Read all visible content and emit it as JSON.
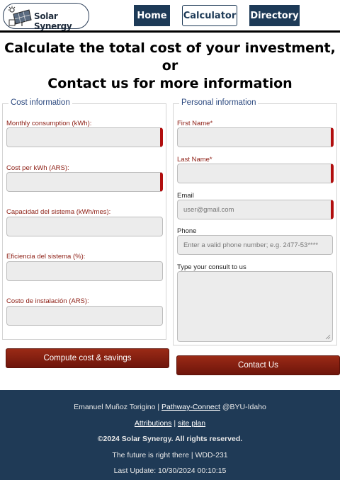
{
  "header": {
    "logo_text": "Solar Synergy",
    "nav": {
      "home": "Home",
      "calculator": "Calculator",
      "directory": "Directory"
    }
  },
  "title": {
    "line1": "Calculate the total cost of your investment, or",
    "line2": "Contact us for more information"
  },
  "cost_form": {
    "legend": "Cost information",
    "monthly_consumption": "Monthly consumption (kWh):",
    "cost_per_kwh": "Cost per kWh (ARS):",
    "system_capacity": "Capacidad del sistema (kWh/mes):",
    "system_efficiency": "Eficiencia del sistema (%):",
    "installation_cost": "Costo de instalación (ARS):",
    "compute_button": "Compute cost & savings"
  },
  "personal_form": {
    "legend": "Personal information",
    "first_name": "First Name*",
    "last_name": "Last Name*",
    "email": "Email",
    "email_placeholder": "user@gmail.com",
    "phone": "Phone",
    "phone_placeholder": "Enter a valid phone number; e.g. 2477-53****",
    "consult": "Type your consult to us",
    "contact_button": "Contact Us"
  },
  "footer": {
    "author": "Emanuel Muñoz Torigino |",
    "pathway_link": "Pathway-Connect",
    "school": "@BYU-Idaho",
    "attributions_link": "Attributions",
    "separator": "|",
    "site_plan_link": "site plan",
    "copyright": "©2024 Solar Synergy. All rights reserved.",
    "tagline": "The future is right there | WDD-231",
    "last_update": "Last Update: 10/30/2024 00:10:15"
  },
  "colors": {
    "navy": "#1d3a57",
    "required_bar": "#b10e0e",
    "button_red": "#7f1d0f",
    "label_red": "#8c1c12",
    "footer_bg": "#1f3a56"
  },
  "icons": [
    "solar-panel-logo-icon",
    "resize-grip-icon"
  ]
}
